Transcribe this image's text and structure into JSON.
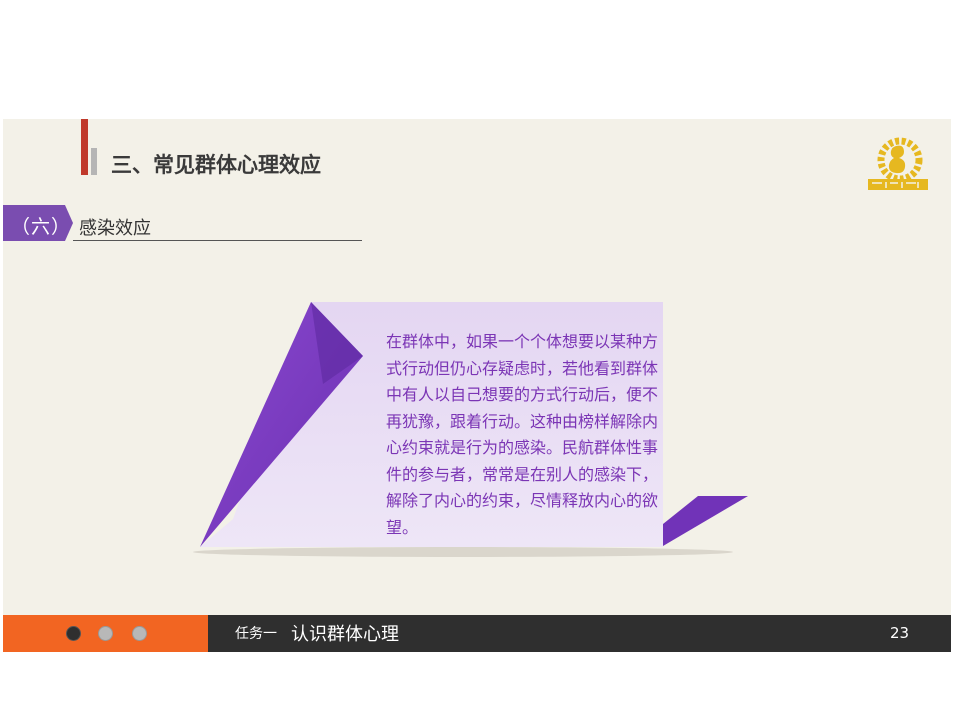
{
  "header": {
    "section_title": "三、常见群体心理效应"
  },
  "subsection": {
    "number_label": "（六）",
    "title": "感染效应"
  },
  "note": {
    "paragraph": "在群体中，如果一个个体想要以某种方式行动但仍心存疑虑时，若他看到群体中有人以自己想要的方式行动后，便不再犹豫，跟着行动。这种由榜样解除内心约束就是行为的感染。民航群体性事件的参与者，常常是在别人的感染下，解除了内心的约束，尽情释放内心的欲望。"
  },
  "footer": {
    "task_label": "任务一",
    "task_title": "认识群体心理",
    "page_number": "23",
    "dots": [
      "active",
      "inactive",
      "inactive"
    ]
  },
  "colors": {
    "accent_red": "#c0392b",
    "purple": "#7b3fc0",
    "footer_orange": "#f26522",
    "footer_dark": "#2f2f2f",
    "logo_gold": "#e6b820"
  }
}
